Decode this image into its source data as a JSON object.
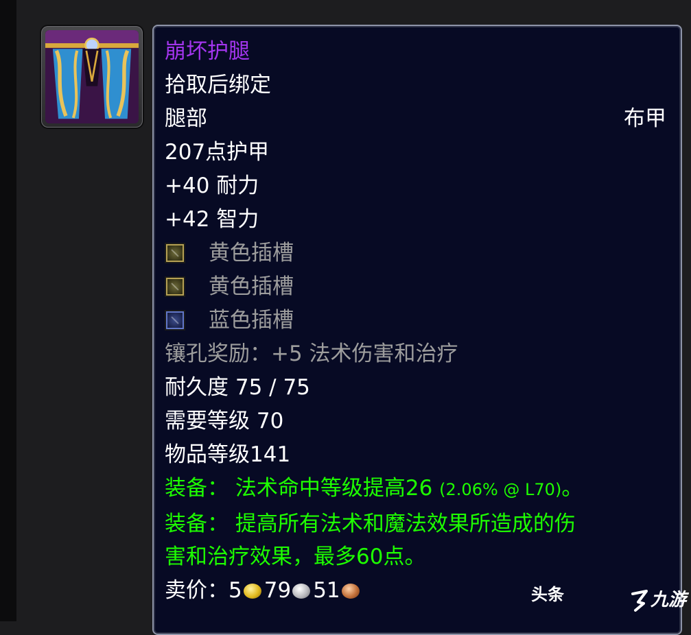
{
  "item": {
    "name": "崩坏护腿",
    "bind": "拾取后绑定",
    "slot": "腿部",
    "armor_type": "布甲",
    "armor": "207点护甲",
    "stats": [
      "+40 耐力",
      "+42 智力"
    ],
    "sockets": [
      {
        "color": "yellow",
        "label": "黄色插槽"
      },
      {
        "color": "yellow",
        "label": "黄色插槽"
      },
      {
        "color": "blue",
        "label": "蓝色插槽"
      }
    ],
    "socket_bonus": "镶孔奖励：+5 法术伤害和治疗",
    "durability": "耐久度 75 / 75",
    "required_level": "需要等级 70",
    "item_level": "物品等级141",
    "equip1_prefix": "装备：  法术命中等级提高26",
    "equip1_note": "(2.06% @ L70)",
    "equip1_end": "。",
    "equip2_line1": "装备：  提高所有法术和魔法效果所造成的伤",
    "equip2_line2": "害和治疗效果，最多60点。",
    "sell_label": "卖价：",
    "sell_gold": "5",
    "sell_silver": "79",
    "sell_copper": "51"
  },
  "watermark": {
    "text1": "头条",
    "text2": "九游"
  },
  "colors": {
    "epic": "#a335ee",
    "green": "#1eff00",
    "gray": "#9d9d9d",
    "tooltip_bg": "#070a24"
  },
  "icons": [
    "leg-armor-icon",
    "yellow-socket-icon",
    "blue-socket-icon",
    "gold-coin-icon",
    "silver-coin-icon",
    "copper-coin-icon"
  ]
}
